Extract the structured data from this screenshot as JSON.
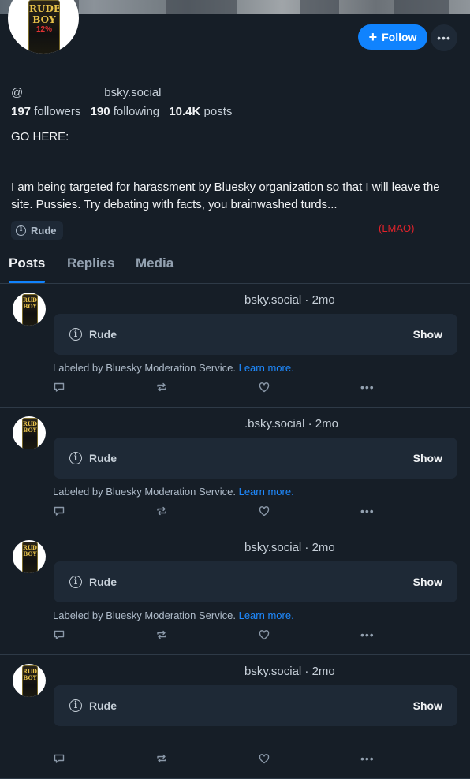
{
  "profile": {
    "follow_label": "Follow",
    "more_label": "•••",
    "handle_prefix": "@",
    "handle_suffix": "bsky.social",
    "stats": {
      "followers_count": "197",
      "followers_label": "followers",
      "following_count": "190",
      "following_label": "following",
      "posts_count": "10.4K",
      "posts_label": "posts"
    },
    "bio_lines": [
      "GO HERE:",
      "I am being targeted for harassment by Bluesky organization so that I will leave the site. Pussies. Try debating with facts, you brainwashed turds..."
    ],
    "label": "Rude",
    "annotation": "(LMAO)",
    "avatar_text": {
      "line1": "RUDE",
      "line2": "BOY",
      "line3": "12%"
    }
  },
  "tabs": [
    {
      "label": "Posts",
      "active": true
    },
    {
      "label": "Replies",
      "active": false
    },
    {
      "label": "Media",
      "active": false
    }
  ],
  "posts": [
    {
      "meta": "bsky.social · 2mo",
      "label": "Rude",
      "show_label": "Show",
      "mod_note": "Labeled by Bluesky Moderation Service.",
      "learn_more": "Learn more."
    },
    {
      "meta": ".bsky.social · 2mo",
      "label": "Rude",
      "show_label": "Show",
      "mod_note": "Labeled by Bluesky Moderation Service.",
      "learn_more": "Learn more."
    },
    {
      "meta": "bsky.social · 2mo",
      "label": "Rude",
      "show_label": "Show",
      "mod_note": "Labeled by Bluesky Moderation Service.",
      "learn_more": "Learn more."
    },
    {
      "meta": "bsky.social · 2mo",
      "label": "Rude",
      "show_label": "Show",
      "mod_note": "",
      "learn_more": ""
    }
  ],
  "icons": {
    "reply": "reply-icon",
    "repost": "repost-icon",
    "like": "like-icon",
    "more": "more-dots-icon"
  },
  "colors": {
    "background": "#161e27",
    "accent": "#1083fe",
    "card": "#1e2936",
    "annotation": "#e0232b"
  }
}
